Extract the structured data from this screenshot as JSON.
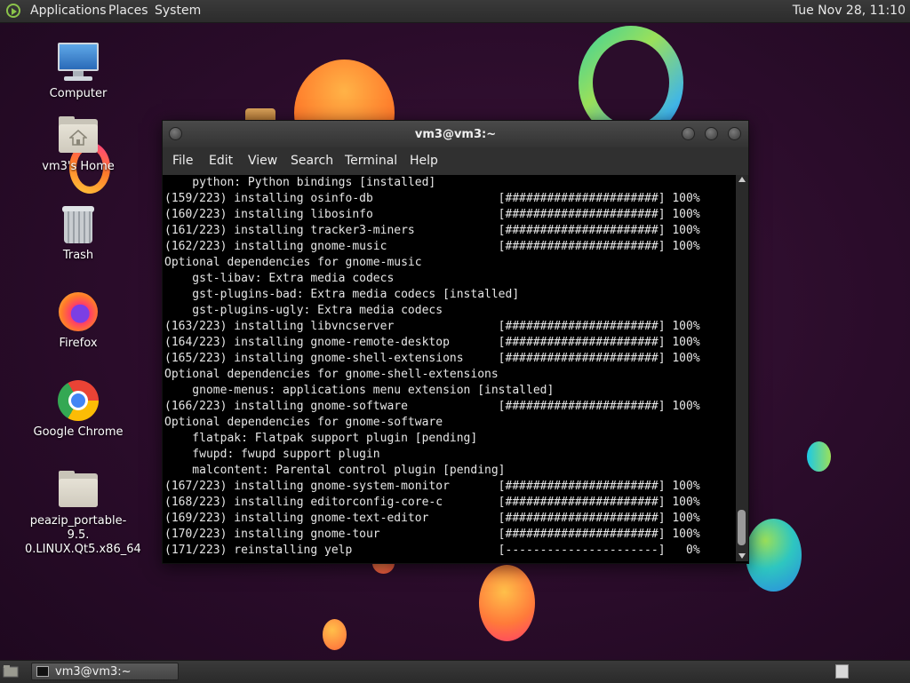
{
  "top_panel": {
    "menus": [
      "Applications",
      "Places",
      "System"
    ],
    "clock": "Tue Nov 28, 11:10"
  },
  "desktop_icons": [
    {
      "label": "Computer",
      "icon": "computer-icon"
    },
    {
      "label": "vm3's Home",
      "icon": "home-folder-icon"
    },
    {
      "label": "Trash",
      "icon": "trash-icon"
    },
    {
      "label": "Firefox",
      "icon": "firefox-icon"
    },
    {
      "label": "Google Chrome",
      "icon": "chrome-icon"
    },
    {
      "label": "peazip_portable-9.5.0.LINUX.Qt5.x86_64",
      "label_line1": "peazip_portable-9.5.",
      "label_line2": "0.LINUX.Qt5.x86_64",
      "icon": "folder-icon"
    }
  ],
  "terminal": {
    "title": "vm3@vm3:~",
    "menu": [
      "File",
      "Edit",
      "View",
      "Search",
      "Terminal",
      "Help"
    ],
    "lines": [
      "    python: Python bindings [installed]",
      "(159/223) installing osinfo-db                  [######################] 100%",
      "(160/223) installing libosinfo                  [######################] 100%",
      "(161/223) installing tracker3-miners            [######################] 100%",
      "(162/223) installing gnome-music                [######################] 100%",
      "Optional dependencies for gnome-music",
      "    gst-libav: Extra media codecs",
      "    gst-plugins-bad: Extra media codecs [installed]",
      "    gst-plugins-ugly: Extra media codecs",
      "(163/223) installing libvncserver               [######################] 100%",
      "(164/223) installing gnome-remote-desktop       [######################] 100%",
      "(165/223) installing gnome-shell-extensions     [######################] 100%",
      "Optional dependencies for gnome-shell-extensions",
      "    gnome-menus: applications menu extension [installed]",
      "(166/223) installing gnome-software             [######################] 100%",
      "Optional dependencies for gnome-software",
      "    flatpak: Flatpak support plugin [pending]",
      "    fwupd: fwupd support plugin",
      "    malcontent: Parental control plugin [pending]",
      "(167/223) installing gnome-system-monitor       [######################] 100%",
      "(168/223) installing editorconfig-core-c        [######################] 100%",
      "(169/223) installing gnome-text-editor          [######################] 100%",
      "(170/223) installing gnome-tour                 [######################] 100%",
      "(171/223) reinstalling yelp                     [----------------------]   0%"
    ]
  },
  "taskbar": {
    "window_button": "vm3@vm3:~"
  },
  "colors": {
    "desktop_bg": "#2a0c2a",
    "panel_bg": "#333333",
    "terminal_bg": "#000000",
    "terminal_fg": "#e6e6e6"
  }
}
